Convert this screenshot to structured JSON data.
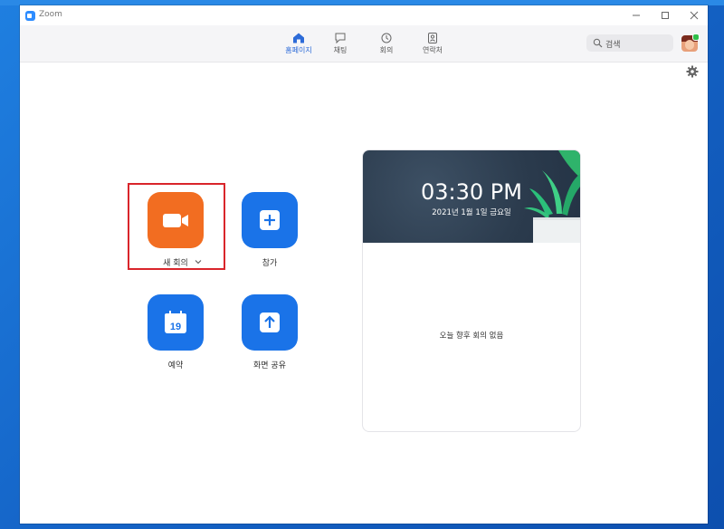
{
  "window": {
    "title": "Zoom"
  },
  "nav": {
    "tabs": [
      {
        "label": "홈페이지",
        "icon": "home-icon",
        "active": true
      },
      {
        "label": "채팅",
        "icon": "chat-icon",
        "active": false
      },
      {
        "label": "회의",
        "icon": "clock-icon",
        "active": false
      },
      {
        "label": "연락처",
        "icon": "contacts-icon",
        "active": false
      }
    ]
  },
  "search": {
    "placeholder": "검색"
  },
  "actions": {
    "new_meeting": {
      "label": "새 회의",
      "icon": "video-camera-icon",
      "color": "#f26d21"
    },
    "join": {
      "label": "참가",
      "icon": "plus-icon",
      "color": "#1a73e8"
    },
    "schedule": {
      "label": "예약",
      "icon": "calendar-icon",
      "calendar_day": "19",
      "color": "#1a73e8"
    },
    "share_screen": {
      "label": "화면 공유",
      "icon": "share-up-arrow-icon",
      "color": "#1a73e8"
    }
  },
  "clock_card": {
    "time": "03:30 PM",
    "date": "2021년 1월 1일 금요일",
    "empty_message": "오늘 향후 회의 없음"
  },
  "colors": {
    "accent": "#2d6bd8",
    "highlight": "#d9252b"
  }
}
